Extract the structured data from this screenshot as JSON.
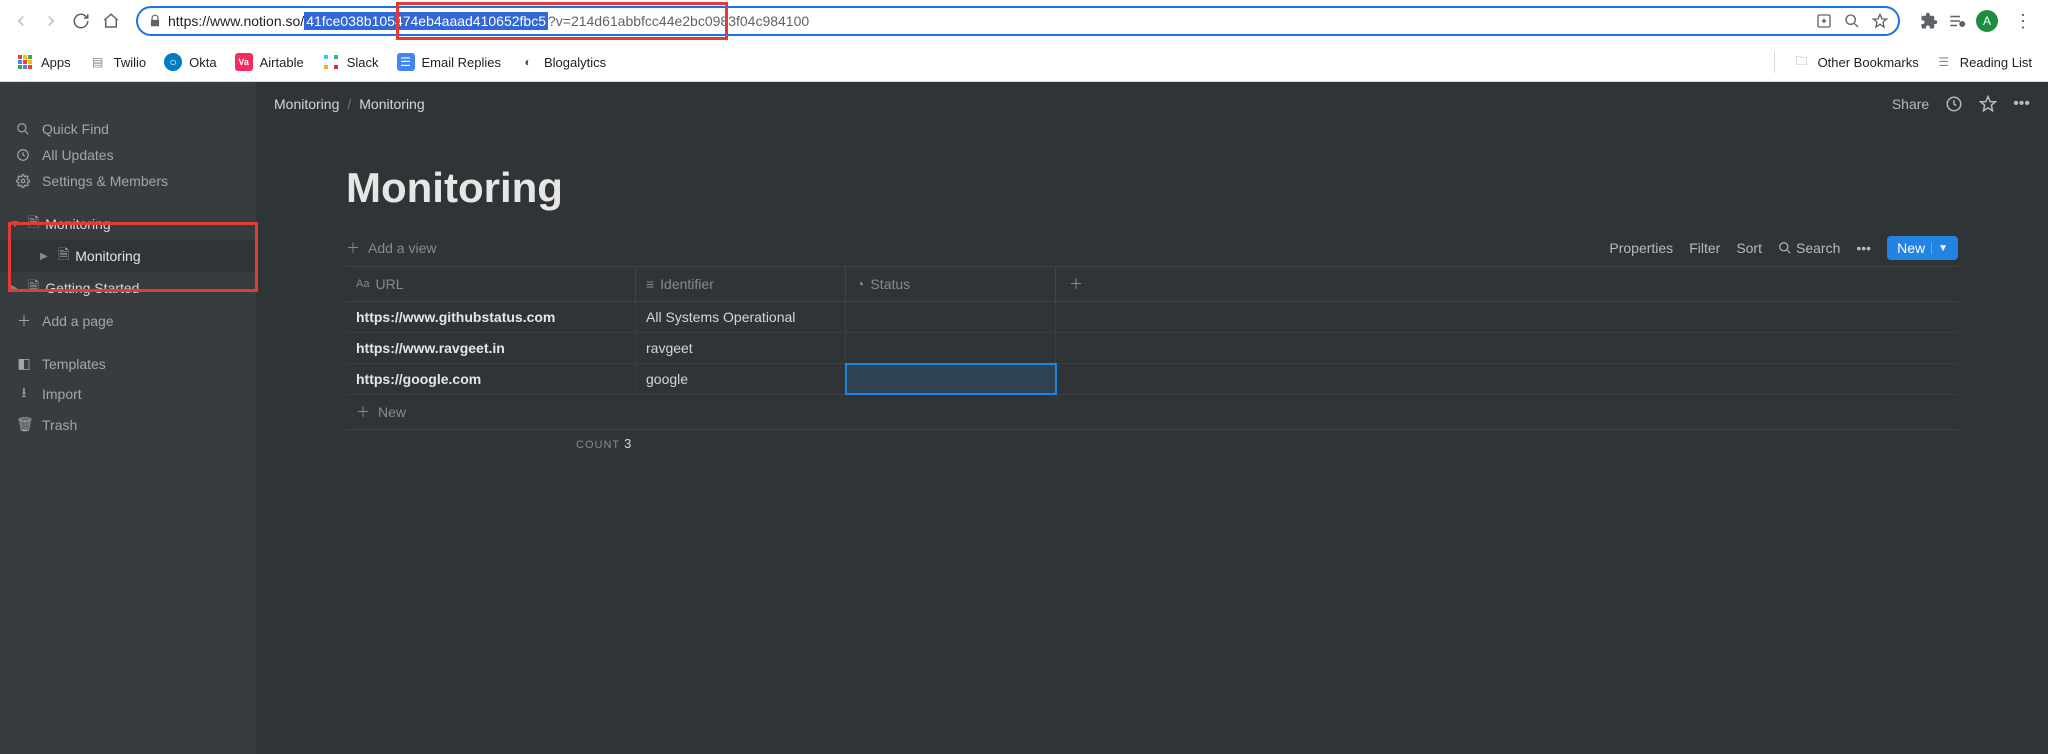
{
  "browser": {
    "url_prefix": "https://www.notion.so/",
    "url_highlighted": "41fce038b105474eb4aaad410652fbc5",
    "url_suffix": "?v=214d61abbfcc44e2bc0983f04c984100",
    "avatar_letter": "A"
  },
  "bookmarks": {
    "apps": "Apps",
    "items": [
      "Twilio",
      "Okta",
      "Airtable",
      "Slack",
      "Email Replies",
      "Blogalytics"
    ],
    "other": "Other Bookmarks",
    "reading_list": "Reading List"
  },
  "sidebar": {
    "quick_find": "Quick Find",
    "all_updates": "All Updates",
    "settings": "Settings & Members",
    "pages": {
      "monitoring": "Monitoring",
      "monitoring_child": "Monitoring",
      "getting_started": "Getting Started"
    },
    "add_page": "Add a page",
    "templates": "Templates",
    "import": "Import",
    "trash": "Trash"
  },
  "breadcrumb": {
    "a": "Monitoring",
    "b": "Monitoring"
  },
  "topbar": {
    "share": "Share"
  },
  "page": {
    "title": "Monitoring"
  },
  "view": {
    "add_view": "Add a view",
    "properties": "Properties",
    "filter": "Filter",
    "sort": "Sort",
    "search": "Search",
    "new": "New"
  },
  "table": {
    "headers": {
      "url": "URL",
      "identifier": "Identifier",
      "status": "Status"
    },
    "rows": [
      {
        "url": "https://www.githubstatus.com",
        "identifier": "All Systems Operational",
        "status": ""
      },
      {
        "url": "https://www.ravgeet.in",
        "identifier": "ravgeet",
        "status": ""
      },
      {
        "url": "https://google.com",
        "identifier": "google",
        "status": ""
      }
    ],
    "new": "New",
    "count_label": "COUNT",
    "count": "3"
  }
}
